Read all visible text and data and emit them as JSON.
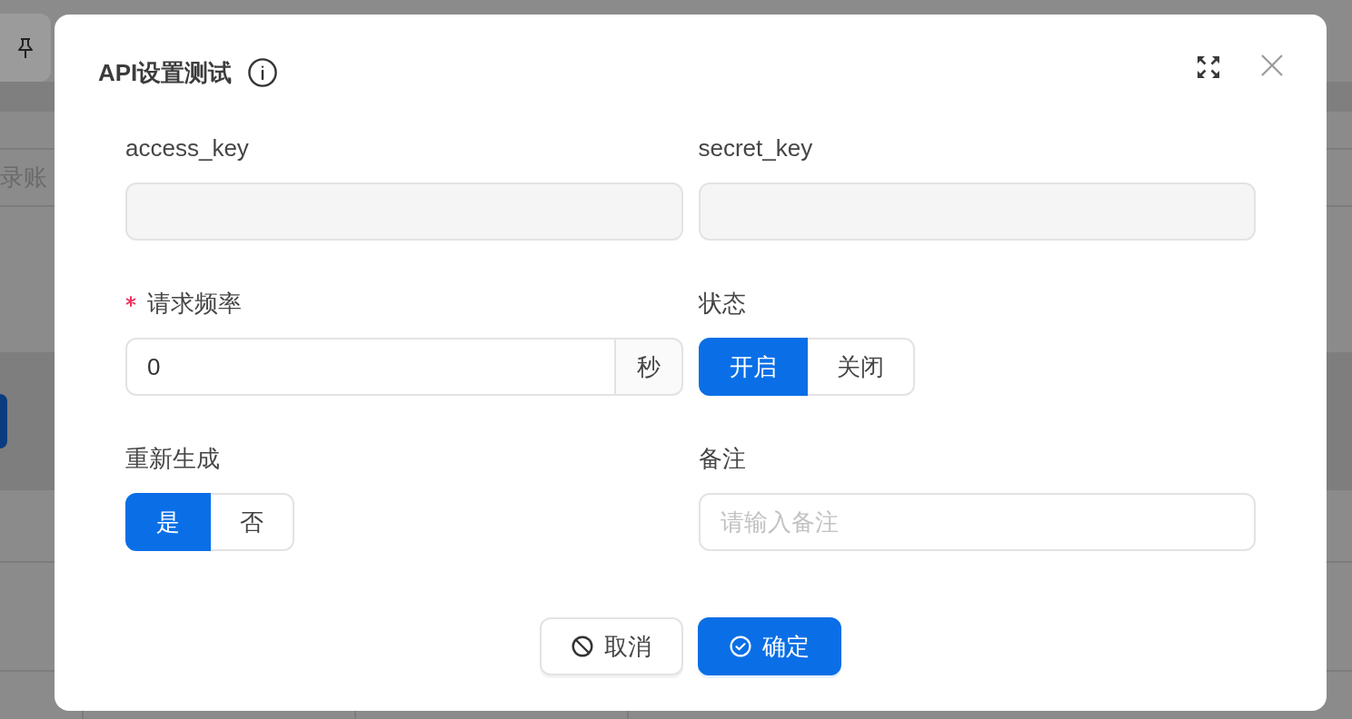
{
  "background": {
    "column_heading": "录账"
  },
  "dialog": {
    "title": "API设置测试"
  },
  "fields": [
    {
      "kind": "readonly",
      "label": "access_key",
      "required": false
    },
    {
      "kind": "readonly",
      "label": "secret_key",
      "required": false
    },
    {
      "kind": "input",
      "label": "请求频率",
      "required": true,
      "value": "0",
      "suffix": "秒"
    },
    {
      "kind": "segmented",
      "label": "状态",
      "required": false,
      "options": [
        {
          "label": "开启",
          "selected": true
        },
        {
          "label": "关闭",
          "selected": false
        }
      ]
    },
    {
      "kind": "segmented",
      "label": "重新生成",
      "required": false,
      "options": [
        {
          "label": "是",
          "selected": true
        },
        {
          "label": "否",
          "selected": false
        }
      ]
    },
    {
      "kind": "input",
      "label": "备注",
      "required": false,
      "placeholder": "请输入备注"
    }
  ],
  "buttons": [
    {
      "kind": "cancel",
      "label": "取消"
    },
    {
      "kind": "confirm",
      "label": "确定"
    }
  ]
}
